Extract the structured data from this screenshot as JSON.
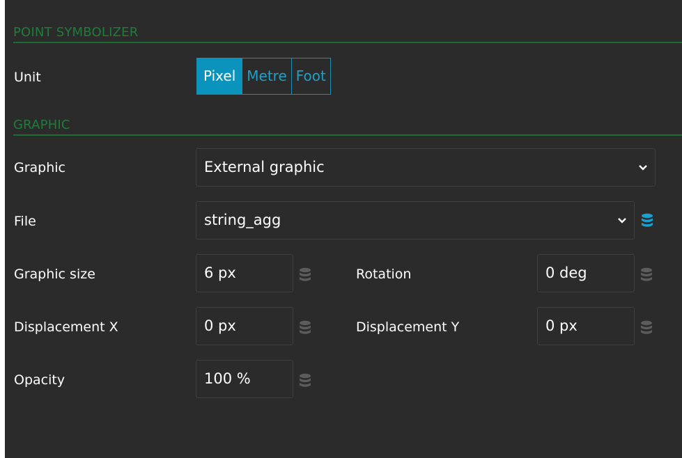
{
  "sections": {
    "point_symbolizer": "POINT SYMBOLIZER",
    "graphic": "GRAPHIC"
  },
  "unit": {
    "label": "Unit",
    "options": [
      "Pixel",
      "Metre",
      "Foot"
    ],
    "selected": "Pixel"
  },
  "graphic": {
    "label": "Graphic",
    "value": "External graphic"
  },
  "file": {
    "label": "File",
    "value": "string_agg",
    "icon": "database-icon",
    "icon_color": "#1a9fcf"
  },
  "graphic_size": {
    "label": "Graphic size",
    "value": "6 px"
  },
  "rotation": {
    "label": "Rotation",
    "value": "0 deg"
  },
  "displacement_x": {
    "label": "Displacement X",
    "value": "0 px"
  },
  "displacement_y": {
    "label": "Displacement Y",
    "value": "0 px"
  },
  "opacity": {
    "label": "Opacity",
    "value": "100 %"
  },
  "colors": {
    "accent": "#0a94bd",
    "section_header": "#1f7c39",
    "panel_bg": "#2b2b2b",
    "inactive_db_icon": "#5c5c5c"
  }
}
